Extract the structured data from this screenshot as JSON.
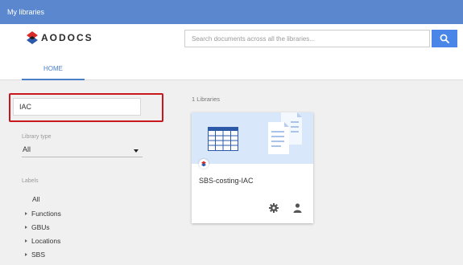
{
  "window": {
    "title": "My libraries"
  },
  "header": {
    "logo_text": "AODOCS",
    "search_placeholder": "Search documents across all the libraries...",
    "tabs": [
      {
        "label": "HOME"
      }
    ]
  },
  "sidebar": {
    "filter_value": "IAC",
    "library_type_label": "Library type",
    "library_type_value": "All",
    "labels_heading": "Labels",
    "labels": [
      {
        "label": "All"
      },
      {
        "label": "Functions"
      },
      {
        "label": "GBUs"
      },
      {
        "label": "Locations"
      },
      {
        "label": "SBS"
      }
    ]
  },
  "main": {
    "library_count": "1 Libraries",
    "libraries": [
      {
        "name": "SBS-costing-IAC"
      }
    ]
  },
  "colors": {
    "titlebar": "#5a87cd",
    "accent": "#4a86e8",
    "highlight": "#c9171e",
    "logo_red": "#d62b26",
    "logo_blue": "#2c5aa8",
    "card_banner": "#d9e7fb"
  },
  "icons": [
    "aodocs-logo-icon",
    "search-icon",
    "spreadsheet-icon",
    "document-icon",
    "aodocs-badge-icon",
    "settings-icon",
    "user-icon"
  ]
}
